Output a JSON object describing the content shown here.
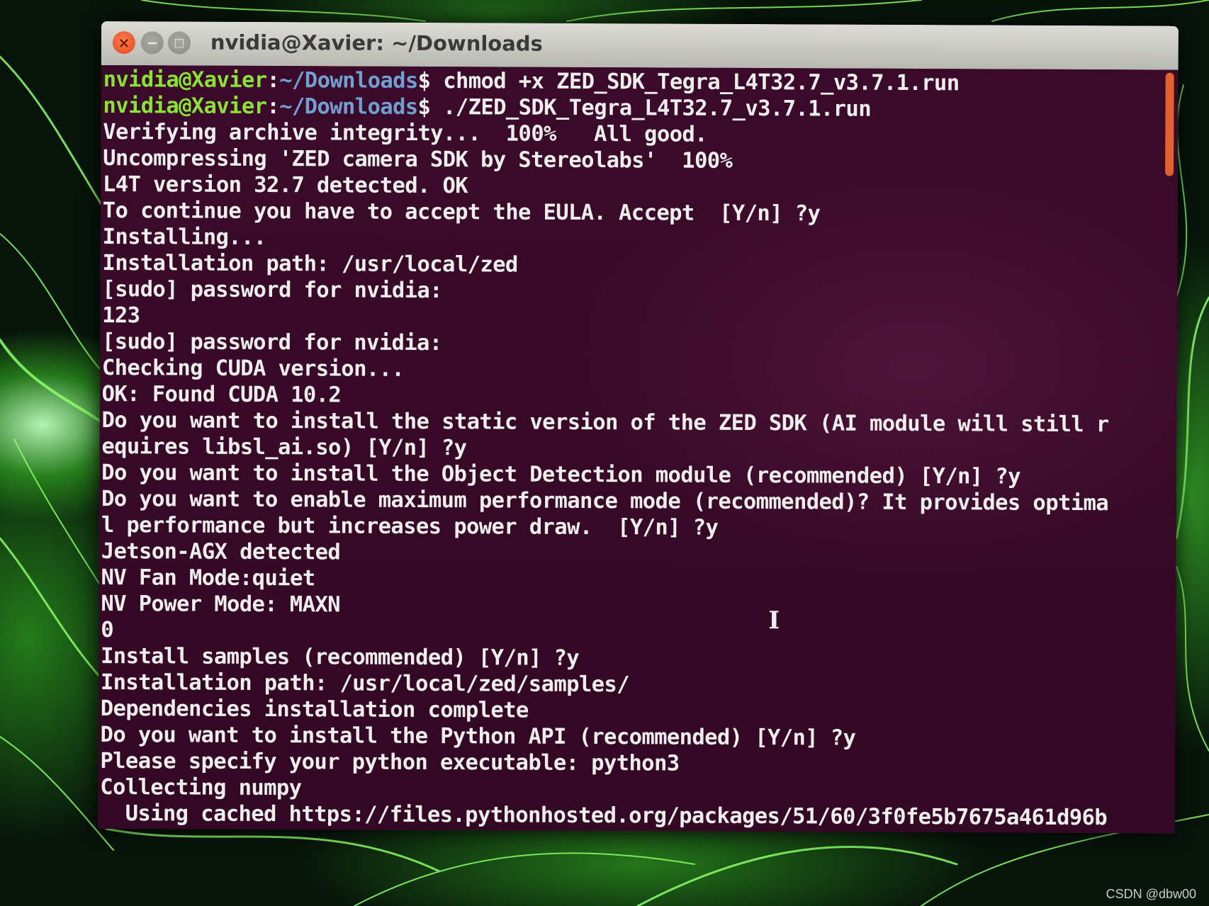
{
  "window": {
    "title": "nvidia@Xavier: ~/Downloads",
    "controls": {
      "close_icon": "×",
      "minimize_icon": "−",
      "maximize_icon": "□"
    }
  },
  "colors": {
    "terminal_background": "#3b0a2a",
    "text": "#eeeeec",
    "prompt_user": "#8ae234",
    "prompt_path": "#729fcf",
    "scrollbar": "#e25f2e",
    "desktop_glow": "#5fd83a"
  },
  "terminal": {
    "prompt_user_host": "nvidia@Xavier",
    "prompt_separator": ":",
    "prompt_path": "~/Downloads",
    "prompt_symbol": "$",
    "command_1": " chmod +x ZED_SDK_Tegra_L4T32.7_v3.7.1.run",
    "command_2": " ./ZED_SDK_Tegra_L4T32.7_v3.7.1.run",
    "output": [
      "Verifying archive integrity...  100%   All good.",
      "Uncompressing 'ZED camera SDK by Stereolabs'  100%",
      "L4T version 32.7 detected. OK",
      "To continue you have to accept the EULA. Accept  [Y/n] ?y",
      "Installing...",
      "Installation path: /usr/local/zed",
      "[sudo] password for nvidia:",
      "123",
      "[sudo] password for nvidia:",
      "Checking CUDA version...",
      "OK: Found CUDA 10.2",
      "Do you want to install the static version of the ZED SDK (AI module will still r",
      "equires libsl_ai.so) [Y/n] ?y",
      "Do you want to install the Object Detection module (recommended) [Y/n] ?y",
      "Do you want to enable maximum performance mode (recommended)? It provides optima",
      "l performance but increases power draw.  [Y/n] ?y",
      "Jetson-AGX detected",
      "NV Fan Mode:quiet",
      "NV Power Mode: MAXN",
      "0",
      "Install samples (recommended) [Y/n] ?y",
      "Installation path: /usr/local/zed/samples/",
      "Dependencies installation complete",
      "Do you want to install the Python API (recommended) [Y/n] ?y",
      "Please specify your python executable: python3",
      "Collecting numpy",
      "  Using cached https://files.pythonhosted.org/packages/51/60/3f0fe5b7675a461d96b"
    ],
    "cursor_icon": "I"
  },
  "watermark": "CSDN @dbw00"
}
